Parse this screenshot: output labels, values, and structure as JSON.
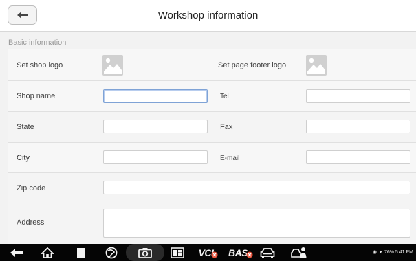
{
  "header": {
    "title": "Workshop information"
  },
  "section": {
    "label": "Basic information"
  },
  "form": {
    "shop_logo_label": "Set shop logo",
    "footer_logo_label": "Set page footer logo",
    "shop_name_label": "Shop name",
    "tel_label": "Tel",
    "state_label": "State",
    "fax_label": "Fax",
    "city_label": "City",
    "email_label": "E-mail",
    "zip_label": "Zip code",
    "address_label": "Address",
    "shop_name_value": "",
    "tel_value": "",
    "state_value": "",
    "fax_value": "",
    "city_value": "",
    "email_value": "",
    "zip_value": "",
    "address_value": ""
  },
  "navbar": {
    "vci_label": "VCI",
    "bas_label": "BAS",
    "status_text": "76%  5:41 PM",
    "icons": [
      "back-arrow-icon",
      "home-icon",
      "recent-apps-icon",
      "browser-icon",
      "camera-icon",
      "screen-record-icon",
      "vci-icon",
      "bas-icon",
      "car-icon",
      "car-service-icon"
    ]
  },
  "colors": {
    "header_bg": "#ffffff",
    "page_bg": "#f2f2f2",
    "focus_border": "#7fa3d6",
    "badge_red": "#e8533b",
    "navbar_bg": "#050505"
  }
}
